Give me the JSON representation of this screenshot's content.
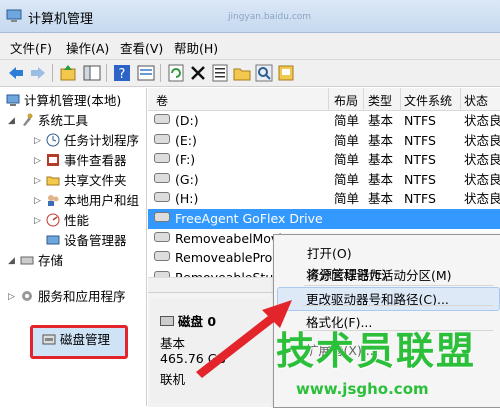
{
  "window": {
    "title": "计算机管理",
    "watermark_top": "jingyan.baidu.com"
  },
  "menu": [
    "文件(F)",
    "操作(A)",
    "查看(V)",
    "帮助(H)"
  ],
  "toolbar_icons": [
    "back-icon",
    "forward-icon",
    "up-icon",
    "console-tree-icon",
    "help-icon",
    "properties-icon",
    "refresh-icon",
    "delete-icon",
    "properties2-icon",
    "open-icon",
    "search-icon",
    "export-icon"
  ],
  "tree": {
    "root": "计算机管理(本地)",
    "system_tools": "系统工具",
    "items": [
      "任务计划程序",
      "事件查看器",
      "共享文件夹",
      "本地用户和组",
      "性能",
      "设备管理器"
    ],
    "storage": "存储",
    "disk_mgmt": "磁盘管理",
    "services": "服务和应用程序"
  },
  "list": {
    "headers": [
      "卷",
      "布局",
      "类型",
      "文件系统",
      "状态"
    ],
    "rows": [
      {
        "vol": "(D:)",
        "layout": "简单",
        "type": "基本",
        "fs": "NTFS",
        "status": "状态良"
      },
      {
        "vol": "(E:)",
        "layout": "简单",
        "type": "基本",
        "fs": "NTFS",
        "status": "状态良"
      },
      {
        "vol": "(F:)",
        "layout": "简单",
        "type": "基本",
        "fs": "NTFS",
        "status": "状态良"
      },
      {
        "vol": "(G:)",
        "layout": "简单",
        "type": "基本",
        "fs": "NTFS",
        "status": "状态良"
      },
      {
        "vol": "(H:)",
        "layout": "简单",
        "type": "基本",
        "fs": "NTFS",
        "status": "状态良"
      },
      {
        "vol": "FreeAgent GoFlex Drive (I:)",
        "layout": "",
        "type": "",
        "fs": "",
        "status": ""
      },
      {
        "vol": "RemoveabelMovie",
        "layout": "",
        "type": "",
        "fs": "",
        "status": ""
      },
      {
        "vol": "RemoveableProGr",
        "layout": "",
        "type": "",
        "fs": "",
        "status": ""
      },
      {
        "vol": "RemoveableStudy",
        "layout": "",
        "type": "",
        "fs": "",
        "status": ""
      }
    ]
  },
  "disk": {
    "name": "磁盘 0",
    "type": "基本",
    "size": "465.76 GB",
    "status": "联机"
  },
  "context_menu": {
    "open": "打开(O)",
    "explorer": "资源管理器(E)",
    "mark_active": "将分区标记为活动分区(M)",
    "change_letter": "更改驱动器号和路径(C)...",
    "format": "格式化(F)...",
    "partial": "扩展卷(X)..."
  },
  "watermark": {
    "main": "技术员联盟",
    "url": "www.jsgho.com"
  },
  "colors": {
    "accent": "#e3252b",
    "selection": "#3399ff",
    "watermark": "#2bbf3a"
  }
}
